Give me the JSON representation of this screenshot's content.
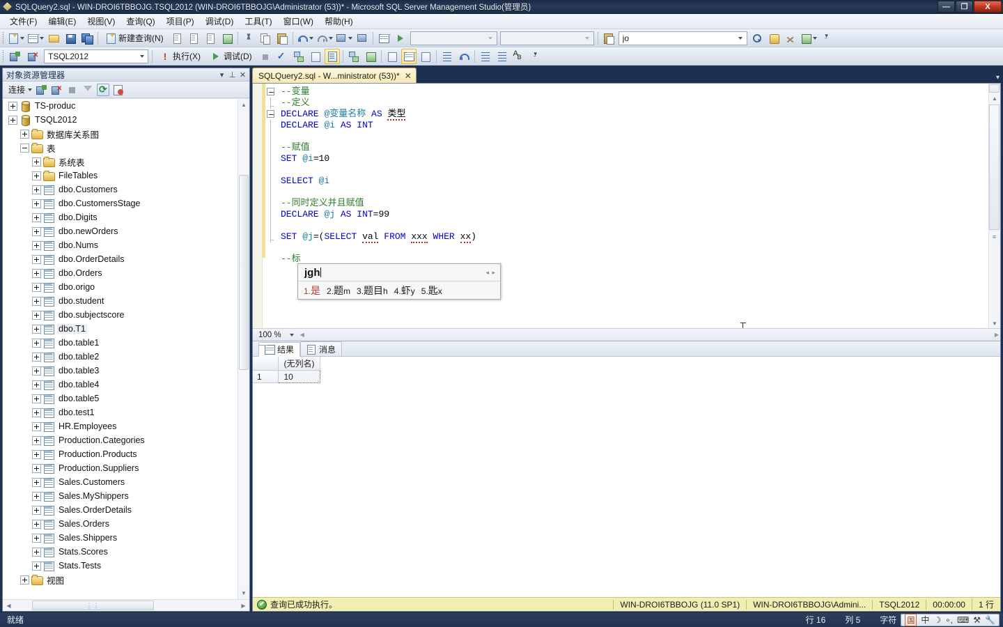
{
  "window": {
    "title": "SQLQuery2.sql - WIN-DROI6TBBOJG.TSQL2012 (WIN-DROI6TBBOJG\\Administrator (53))* - Microsoft SQL Server Management Studio(管理员)",
    "minimize_label": "—",
    "restore_label": "❐",
    "close_label": "X"
  },
  "menubar": {
    "items": [
      {
        "label": "文件(F)"
      },
      {
        "label": "编辑(E)"
      },
      {
        "label": "视图(V)"
      },
      {
        "label": "查询(Q)"
      },
      {
        "label": "项目(P)"
      },
      {
        "label": "调试(D)"
      },
      {
        "label": "工具(T)"
      },
      {
        "label": "窗口(W)"
      },
      {
        "label": "帮助(H)"
      }
    ]
  },
  "toolbar_main": {
    "new_query_label": "新建查询(N)",
    "icons": [
      "new-project-icon",
      "new-item-icon",
      "open-file-icon",
      "save-icon",
      "save-all-icon",
      "new-query-icon",
      "new-database-engine-query-icon",
      "new-analysis-services-mdx-query-icon",
      "new-analysis-services-dmx-query-icon",
      "new-integration-services-query-icon",
      "cut-icon",
      "copy-icon",
      "paste-icon",
      "undo-icon",
      "redo-icon",
      "navigate-backward-icon",
      "navigate-forward-icon",
      "object-explorer-details-icon",
      "start-debug-icon"
    ],
    "combo_empty_1": "",
    "combo_empty_2": "",
    "find_value": "jo",
    "find_placeholder": "",
    "right_icons": [
      "find-in-files-icon",
      "toolbox-icon",
      "properties-window-icon",
      "object-explorer-icon"
    ]
  },
  "toolbar_sql": {
    "database_combo_value": "TSQL2012",
    "execute_label": "执行(X)",
    "debug_label": "调试(D)",
    "icons": [
      "connect-icon",
      "disconnect-icon",
      "execute-bang-icon",
      "debug-play-icon",
      "stop-icon",
      "parse-check-icon",
      "display-estimated-plan-icon",
      "query-options-icon",
      "results-to-text-icon",
      "include-actual-plan-icon",
      "include-client-statistics-icon",
      "results-to-grid-icon",
      "results-to-file-icon",
      "results-to-text2-icon",
      "comment-icon",
      "uncomment-icon",
      "decrease-indent-icon",
      "increase-indent-icon",
      "format-az-icon"
    ]
  },
  "object_explorer": {
    "title": "对象资源管理器",
    "header_buttons": {
      "dropdown": "▾",
      "pin": "⊥",
      "close": "✕"
    },
    "toolbar": {
      "connect_label": "连接",
      "icons": [
        "connect-icon",
        "disconnect-icon",
        "stop-icon",
        "filter-icon",
        "refresh-icon",
        "script-icon"
      ]
    },
    "tree": [
      {
        "indent": 0,
        "expander": "plus",
        "icon": "database-icon",
        "label": "TS-produc"
      },
      {
        "indent": 0,
        "expander": "plus",
        "icon": "database-icon",
        "label": "TSQL2012"
      },
      {
        "indent": 1,
        "expander": "plus",
        "icon": "folder-icon",
        "label": "数据库关系图"
      },
      {
        "indent": 1,
        "expander": "minus",
        "icon": "folder-icon",
        "label": "表"
      },
      {
        "indent": 2,
        "expander": "plus",
        "icon": "folder-icon",
        "label": "系统表"
      },
      {
        "indent": 2,
        "expander": "plus",
        "icon": "folder-icon",
        "label": "FileTables"
      },
      {
        "indent": 2,
        "expander": "plus",
        "icon": "table-icon",
        "label": "dbo.Customers"
      },
      {
        "indent": 2,
        "expander": "plus",
        "icon": "table-icon",
        "label": "dbo.CustomersStage"
      },
      {
        "indent": 2,
        "expander": "plus",
        "icon": "table-icon",
        "label": "dbo.Digits"
      },
      {
        "indent": 2,
        "expander": "plus",
        "icon": "table-icon",
        "label": "dbo.newOrders"
      },
      {
        "indent": 2,
        "expander": "plus",
        "icon": "table-icon",
        "label": "dbo.Nums"
      },
      {
        "indent": 2,
        "expander": "plus",
        "icon": "table-icon",
        "label": "dbo.OrderDetails"
      },
      {
        "indent": 2,
        "expander": "plus",
        "icon": "table-icon",
        "label": "dbo.Orders"
      },
      {
        "indent": 2,
        "expander": "plus",
        "icon": "table-icon",
        "label": "dbo.origo"
      },
      {
        "indent": 2,
        "expander": "plus",
        "icon": "table-icon",
        "label": "dbo.student"
      },
      {
        "indent": 2,
        "expander": "plus",
        "icon": "table-icon",
        "label": "dbo.subjectscore"
      },
      {
        "indent": 2,
        "expander": "plus",
        "icon": "table-icon",
        "label": "dbo.T1",
        "highlight": true
      },
      {
        "indent": 2,
        "expander": "plus",
        "icon": "table-icon",
        "label": "dbo.table1"
      },
      {
        "indent": 2,
        "expander": "plus",
        "icon": "table-icon",
        "label": "dbo.table2"
      },
      {
        "indent": 2,
        "expander": "plus",
        "icon": "table-icon",
        "label": "dbo.table3"
      },
      {
        "indent": 2,
        "expander": "plus",
        "icon": "table-icon",
        "label": "dbo.table4"
      },
      {
        "indent": 2,
        "expander": "plus",
        "icon": "table-icon",
        "label": "dbo.table5"
      },
      {
        "indent": 2,
        "expander": "plus",
        "icon": "table-icon",
        "label": "dbo.test1"
      },
      {
        "indent": 2,
        "expander": "plus",
        "icon": "table-icon",
        "label": "HR.Employees"
      },
      {
        "indent": 2,
        "expander": "plus",
        "icon": "table-icon",
        "label": "Production.Categories"
      },
      {
        "indent": 2,
        "expander": "plus",
        "icon": "table-icon",
        "label": "Production.Products"
      },
      {
        "indent": 2,
        "expander": "plus",
        "icon": "table-icon",
        "label": "Production.Suppliers"
      },
      {
        "indent": 2,
        "expander": "plus",
        "icon": "table-icon",
        "label": "Sales.Customers"
      },
      {
        "indent": 2,
        "expander": "plus",
        "icon": "table-icon",
        "label": "Sales.MyShippers"
      },
      {
        "indent": 2,
        "expander": "plus",
        "icon": "table-icon",
        "label": "Sales.OrderDetails"
      },
      {
        "indent": 2,
        "expander": "plus",
        "icon": "table-icon",
        "label": "Sales.Orders"
      },
      {
        "indent": 2,
        "expander": "plus",
        "icon": "table-icon",
        "label": "Sales.Shippers"
      },
      {
        "indent": 2,
        "expander": "plus",
        "icon": "table-icon",
        "label": "Stats.Scores"
      },
      {
        "indent": 2,
        "expander": "plus",
        "icon": "table-icon",
        "label": "Stats.Tests"
      },
      {
        "indent": 1,
        "expander": "plus",
        "icon": "folder-icon",
        "label": "视图"
      }
    ]
  },
  "editor": {
    "tab_label": "SQLQuery2.sql - W...ministrator (53))*",
    "tab_close": "✕",
    "zoom_value": "100 %",
    "code_lines": [
      {
        "fold": "box",
        "tokens": [
          {
            "t": "--变量",
            "c": "cm"
          }
        ]
      },
      {
        "fold": "elbow",
        "tokens": [
          {
            "t": "--定义",
            "c": "cm"
          }
        ]
      },
      {
        "fold": "box",
        "tokens": [
          {
            "t": "DECLARE",
            "c": "kw"
          },
          {
            "t": " ",
            "c": ""
          },
          {
            "t": "@变量名称",
            "c": "var"
          },
          {
            "t": " ",
            "c": ""
          },
          {
            "t": "AS",
            "c": "kw"
          },
          {
            "t": " ",
            "c": ""
          },
          {
            "t": "类型",
            "c": "sq"
          }
        ]
      },
      {
        "fold": "line",
        "tokens": [
          {
            "t": "DECLARE",
            "c": "kw"
          },
          {
            "t": " ",
            "c": ""
          },
          {
            "t": "@i",
            "c": "var"
          },
          {
            "t": " ",
            "c": ""
          },
          {
            "t": "AS",
            "c": "kw"
          },
          {
            "t": " ",
            "c": ""
          },
          {
            "t": "INT",
            "c": "kw"
          }
        ]
      },
      {
        "fold": "line",
        "tokens": []
      },
      {
        "fold": "line",
        "tokens": [
          {
            "t": "--赋值",
            "c": "cm"
          }
        ]
      },
      {
        "fold": "line",
        "tokens": [
          {
            "t": "SET",
            "c": "kw"
          },
          {
            "t": " ",
            "c": ""
          },
          {
            "t": "@i",
            "c": "var"
          },
          {
            "t": "=10",
            "c": ""
          }
        ]
      },
      {
        "fold": "line",
        "tokens": []
      },
      {
        "fold": "line",
        "tokens": [
          {
            "t": "SELECT",
            "c": "kw"
          },
          {
            "t": " ",
            "c": ""
          },
          {
            "t": "@i",
            "c": "var"
          }
        ]
      },
      {
        "fold": "line",
        "tokens": []
      },
      {
        "fold": "line",
        "tokens": [
          {
            "t": "--同时定义并且赋值",
            "c": "cm"
          }
        ]
      },
      {
        "fold": "line",
        "tokens": [
          {
            "t": "DECLARE",
            "c": "kw"
          },
          {
            "t": " ",
            "c": ""
          },
          {
            "t": "@j",
            "c": "var"
          },
          {
            "t": " ",
            "c": ""
          },
          {
            "t": "AS",
            "c": "kw"
          },
          {
            "t": " ",
            "c": ""
          },
          {
            "t": "INT",
            "c": "kw"
          },
          {
            "t": "=99",
            "c": ""
          }
        ]
      },
      {
        "fold": "line",
        "tokens": []
      },
      {
        "fold": "elbow",
        "tokens": [
          {
            "t": "SET",
            "c": "kw"
          },
          {
            "t": " ",
            "c": ""
          },
          {
            "t": "@j",
            "c": "var"
          },
          {
            "t": "=(",
            "c": ""
          },
          {
            "t": "SELECT",
            "c": "kw"
          },
          {
            "t": " ",
            "c": ""
          },
          {
            "t": "val",
            "c": "sq"
          },
          {
            "t": " ",
            "c": ""
          },
          {
            "t": "FROM",
            "c": "kw"
          },
          {
            "t": " ",
            "c": ""
          },
          {
            "t": "xxx",
            "c": "sq"
          },
          {
            "t": " ",
            "c": ""
          },
          {
            "t": "WHER",
            "c": "kw"
          },
          {
            "t": " ",
            "c": ""
          },
          {
            "t": "xx",
            "c": "sq"
          },
          {
            "t": ")",
            "c": ""
          }
        ]
      },
      {
        "fold": "none",
        "tokens": []
      },
      {
        "fold": "none",
        "tokens": [
          {
            "t": "--标",
            "c": "cm"
          }
        ]
      }
    ],
    "ime": {
      "composition": "jgh",
      "nav_arrows": "◂ ▸",
      "candidates": [
        {
          "index": "1.",
          "word": "是",
          "key": ""
        },
        {
          "index": "2.",
          "word": "题",
          "key": "m"
        },
        {
          "index": "3.",
          "word": "题目",
          "key": "h"
        },
        {
          "index": "4.",
          "word": "虾",
          "key": "y"
        },
        {
          "index": "5.",
          "word": "匙",
          "key": "x"
        }
      ]
    }
  },
  "results": {
    "tabs": [
      {
        "label": "结果",
        "icon": "grid-icon",
        "active": true
      },
      {
        "label": "消息",
        "icon": "message-icon",
        "active": false
      }
    ],
    "columns": [
      "(无列名)"
    ],
    "rows": [
      {
        "num": "1",
        "values": [
          "10"
        ]
      }
    ]
  },
  "query_status": {
    "message": "查询已成功执行。",
    "ok_glyph": "✔",
    "segments": [
      "WIN-DROI6TBBOJG (11.0 SP1)",
      "WIN-DROI6TBBOJG\\Admini...",
      "TSQL2012",
      "00:00:00",
      "1 行"
    ]
  },
  "app_status": {
    "ready": "就绪",
    "line": "行 16",
    "column": "列 5",
    "char": "字符",
    "ime_tray": {
      "mode_box": "国",
      "lang": "中",
      "shape": "☽",
      "punct": "∘,",
      "keyboard": "⌨",
      "tools": "⚒",
      "settings": "🔧"
    }
  }
}
